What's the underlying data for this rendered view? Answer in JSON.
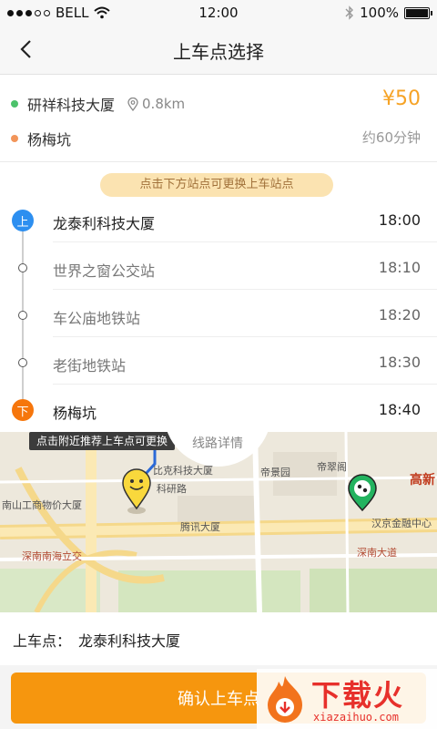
{
  "status_bar": {
    "carrier": "BELL",
    "time": "12:00",
    "battery": "100%"
  },
  "nav": {
    "title": "上车点选择"
  },
  "trip": {
    "origin": "研祥科技大厦",
    "distance": "0.8km",
    "destination": "杨梅坑",
    "price": "¥50",
    "duration": "约60分钟"
  },
  "hint": "点击下方站点可更换上车站点",
  "stops": [
    {
      "marker": "上",
      "name": "龙泰利科技大厦",
      "time": "18:00"
    },
    {
      "name": "世界之窗公交站",
      "time": "18:10"
    },
    {
      "name": "车公庙地铁站",
      "time": "18:20"
    },
    {
      "name": "老街地铁站",
      "time": "18:30"
    },
    {
      "marker": "下",
      "name": "杨梅坑",
      "time": "18:40"
    }
  ],
  "map": {
    "tip": "点击附近推荐上车点可更换",
    "route_details": "线路详情",
    "labels": {
      "bldg1": "比克科技大厦",
      "road1": "科研路",
      "park": "帝景园",
      "bldg2": "帝翠阁",
      "district": "高新",
      "bldg3": "南山工商物价大厦",
      "bldg4": "腾讯大厦",
      "bldg5": "汉京金融中心",
      "junction": "深南南海立交",
      "avenue": "深南大道"
    }
  },
  "pickup": {
    "label": "上车点：",
    "value": "龙泰利科技大厦"
  },
  "confirm_label": "确认上车点",
  "watermark": {
    "title": "下载火",
    "url": "xiazaihuo.com"
  },
  "colors": {
    "accent": "#f6960e",
    "price": "#f6a326",
    "board_marker": "#2d8ff0",
    "alight_marker": "#f6760c"
  }
}
